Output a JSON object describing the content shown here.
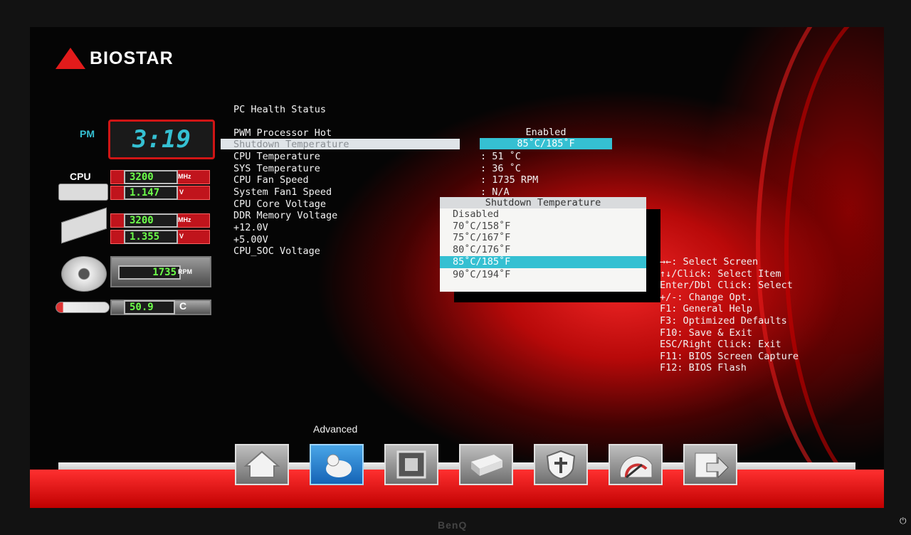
{
  "brand": {
    "logo": "BIOSTAR",
    "monitor": "BenQ"
  },
  "status_panel": {
    "clock": {
      "period": "PM",
      "time": "3:19"
    },
    "cpu": {
      "label": "CPU",
      "freq": "3200",
      "freq_unit": "MHz",
      "voltage": "1.147",
      "voltage_unit": "V"
    },
    "memory": {
      "freq": "3200",
      "freq_unit": "MHz",
      "voltage": "1.355",
      "voltage_unit": "V"
    },
    "fan": {
      "rpm": "1735",
      "unit": "RPM"
    },
    "temp": {
      "value": "50.9",
      "unit": "C"
    }
  },
  "main": {
    "section_title": "PC Health Status",
    "items": [
      {
        "label": "PWM Processor Hot",
        "value": "Enabled"
      },
      {
        "label": "Shutdown Temperature",
        "value": "85˚C/185˚F"
      },
      {
        "label": "CPU Temperature",
        "value": ": 51 ˚C"
      },
      {
        "label": "SYS Temperature",
        "value": ": 36 ˚C"
      },
      {
        "label": "CPU Fan Speed",
        "value": ": 1735 RPM"
      },
      {
        "label": "System Fan1 Speed",
        "value": ": N/A"
      },
      {
        "label": "CPU Core Voltage",
        "value": ""
      },
      {
        "label": "DDR Memory Voltage",
        "value": ""
      },
      {
        "label": "+12.0V",
        "value": ""
      },
      {
        "label": "+5.00V",
        "value": ""
      },
      {
        "label": "CPU_SOC Voltage",
        "value": ""
      }
    ]
  },
  "popup": {
    "title": "Shutdown Temperature",
    "options": [
      "Disabled",
      "70˚C/158˚F",
      "75˚C/167˚F",
      "80˚C/176˚F",
      "85˚C/185˚F",
      "90˚C/194˚F"
    ],
    "selected_index": 4
  },
  "help": [
    "→←: Select Screen",
    "↑↓/Click: Select Item",
    "Enter/Dbl Click: Select",
    "+/-: Change Opt.",
    "F1: General Help",
    "F3: Optimized Defaults",
    "F10: Save & Exit",
    "ESC/Right Click: Exit",
    "F11: BIOS Screen Capture",
    "F12: BIOS Flash"
  ],
  "nav": {
    "active_label": "Advanced",
    "tabs": [
      {
        "icon": "home-icon"
      },
      {
        "icon": "advanced-icon"
      },
      {
        "icon": "chipset-icon"
      },
      {
        "icon": "boot-icon"
      },
      {
        "icon": "security-icon"
      },
      {
        "icon": "o-n-e-icon"
      },
      {
        "icon": "exit-icon"
      }
    ]
  },
  "colors": {
    "accent": "#35c0d2",
    "brand_red": "#e21b1b",
    "readout_green": "#6dff4a"
  }
}
